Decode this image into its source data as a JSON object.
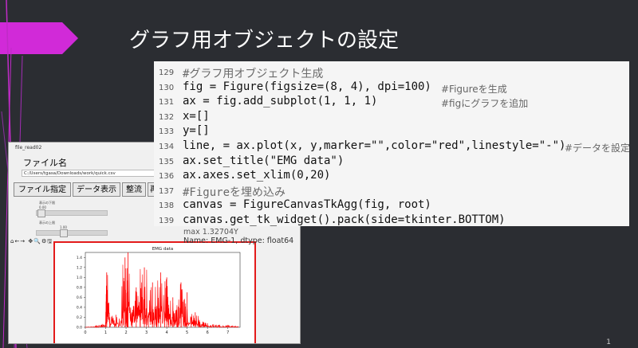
{
  "slide": {
    "title": "グラフ用オブジェクトの設定",
    "page_number": "1"
  },
  "app": {
    "window_title": "file_read02",
    "file_label": "ファイル名",
    "file_path": "C:/Users/tgasa/Downloads/work/quick.csv",
    "buttons": [
      "ファイル指定",
      "データ表示",
      "整流",
      "再"
    ],
    "slider1_label": "表示の下限",
    "slider1_value": "0.00",
    "slider2_label": "表示の上限",
    "slider2_value": "1.00",
    "toolbar_icons": "⌂←→ ✥🔍⚙🖫"
  },
  "series_info": {
    "max_line": "max      1.32704Y",
    "name_line": "Name: EMG-1, dtype: float64"
  },
  "code": [
    {
      "no": "129",
      "text": "#グラフ用オブジェクト生成",
      "is_comment": true,
      "comment": ""
    },
    {
      "no": "130",
      "text": "fig = Figure(figsize=(8, 4), dpi=100)",
      "is_comment": false,
      "comment": "#Figureを生成"
    },
    {
      "no": "131",
      "text": "ax = fig.add_subplot(1, 1, 1)",
      "is_comment": false,
      "comment": "#figにグラフを追加"
    },
    {
      "no": "132",
      "text": "x=[]",
      "is_comment": false,
      "comment": ""
    },
    {
      "no": "133",
      "text": "y=[]",
      "is_comment": false,
      "comment": ""
    },
    {
      "no": "134",
      "text": "line, = ax.plot(x, y,marker=\"\",color=\"red\",linestyle=\"-\")",
      "is_comment": false,
      "comment": "#データを設定"
    },
    {
      "no": "135",
      "text": "ax.set_title(\"EMG data\")",
      "is_comment": false,
      "comment": ""
    },
    {
      "no": "136",
      "text": "ax.axes.set_xlim(0,20)",
      "is_comment": false,
      "comment": ""
    },
    {
      "no": "137",
      "text": "#Figureを埋め込み",
      "is_comment": true,
      "comment": ""
    },
    {
      "no": "138",
      "text": "canvas = FigureCanvasTkAgg(fig, root)",
      "is_comment": false,
      "comment": ""
    },
    {
      "no": "139",
      "text": "canvas.get_tk_widget().pack(side=tkinter.BOTTOM)",
      "is_comment": false,
      "comment": ""
    }
  ],
  "chart_data": {
    "type": "line",
    "title": "EMG data",
    "xlabel": "",
    "ylabel": "",
    "xlim": [
      0,
      7.6
    ],
    "ylim": [
      0,
      1.5
    ],
    "x_ticks": [
      "0",
      "1",
      "2",
      "3",
      "4",
      "5",
      "6",
      "7"
    ],
    "y_ticks": [
      "0.0",
      "0.2",
      "0.4",
      "0.6",
      "0.8",
      "1.0",
      "1.2",
      "1.4"
    ],
    "series": [
      {
        "color": "#ff0000",
        "x": [
          0.0,
          0.5,
          0.8,
          1.0,
          1.05,
          1.2,
          1.5,
          1.8,
          1.95,
          2.05,
          2.1,
          2.3,
          2.5,
          2.7,
          2.9,
          3.1,
          3.3,
          3.5,
          3.7,
          3.9,
          4.0,
          4.1,
          4.3,
          4.5,
          4.7,
          4.9,
          5.0,
          5.2,
          5.4,
          5.6,
          5.8,
          6.0,
          6.3,
          6.6,
          6.9,
          7.2,
          7.5
        ],
        "y": [
          0.0,
          0.02,
          0.05,
          0.1,
          1.1,
          0.2,
          0.25,
          0.3,
          1.4,
          0.4,
          1.5,
          0.3,
          0.8,
          0.2,
          1.2,
          0.3,
          0.9,
          0.4,
          1.1,
          0.2,
          1.0,
          0.3,
          0.6,
          0.2,
          0.9,
          0.15,
          0.7,
          0.2,
          0.3,
          0.15,
          0.1,
          0.08,
          0.06,
          0.05,
          0.04,
          0.03,
          0.02
        ]
      }
    ]
  }
}
